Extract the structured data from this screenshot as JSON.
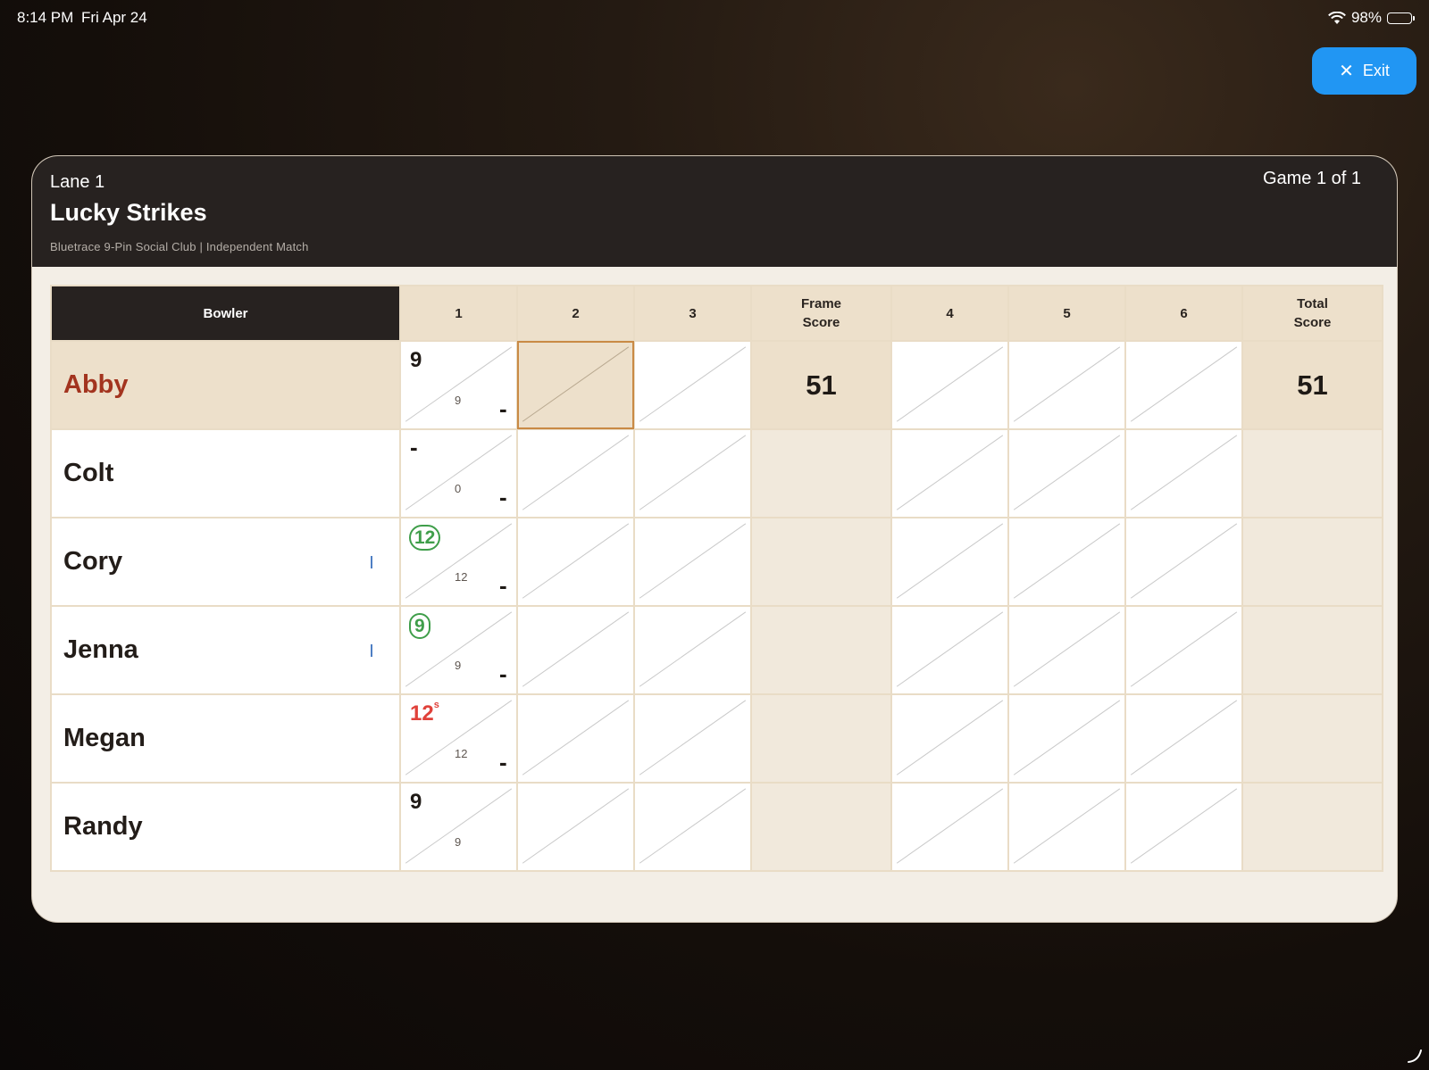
{
  "status": {
    "time": "8:14 PM",
    "date": "Fri Apr 24",
    "battery": "98%",
    "battery_level": 0.98
  },
  "exit_label": "Exit",
  "header": {
    "lane": "Lane 1",
    "team": "Lucky Strikes",
    "club": "Bluetrace 9-Pin Social Club | Independent Match",
    "game": "Game 1 of 1"
  },
  "columns": {
    "bowler": "Bowler",
    "f1": "1",
    "f2": "2",
    "f3": "3",
    "frame_score_1": "Frame",
    "frame_score_2": "Score",
    "f4": "4",
    "f5": "5",
    "f6": "6",
    "total_score_1": "Total",
    "total_score_2": "Score"
  },
  "bowlers": [
    {
      "name": "Abby",
      "f1_top": "9",
      "f1_running": "9",
      "f1_second": "-",
      "frame_score": "51",
      "total_score": "51"
    },
    {
      "name": "Colt",
      "f1_top": "-",
      "f1_running": "0",
      "f1_second": "-",
      "frame_score": "",
      "total_score": ""
    },
    {
      "name": "Cory",
      "f1_top": "12",
      "f1_running": "12",
      "f1_second": "-",
      "frame_score": "",
      "total_score": ""
    },
    {
      "name": "Jenna",
      "f1_top": "9",
      "f1_running": "9",
      "f1_second": "-",
      "frame_score": "",
      "total_score": ""
    },
    {
      "name": "Megan",
      "f1_top": "12",
      "f1_top_sup": "s",
      "f1_running": "12",
      "f1_second": "-",
      "frame_score": "",
      "total_score": ""
    },
    {
      "name": "Randy",
      "f1_top": "9",
      "f1_running": "9",
      "f1_second": "",
      "frame_score": "",
      "total_score": ""
    }
  ],
  "colors": {
    "exit_button": "#2196f3",
    "active_name": "#a3341f",
    "clean_pill": "#3f9e4a",
    "split": "#e0413a",
    "selected_frame": "#c98a45"
  }
}
